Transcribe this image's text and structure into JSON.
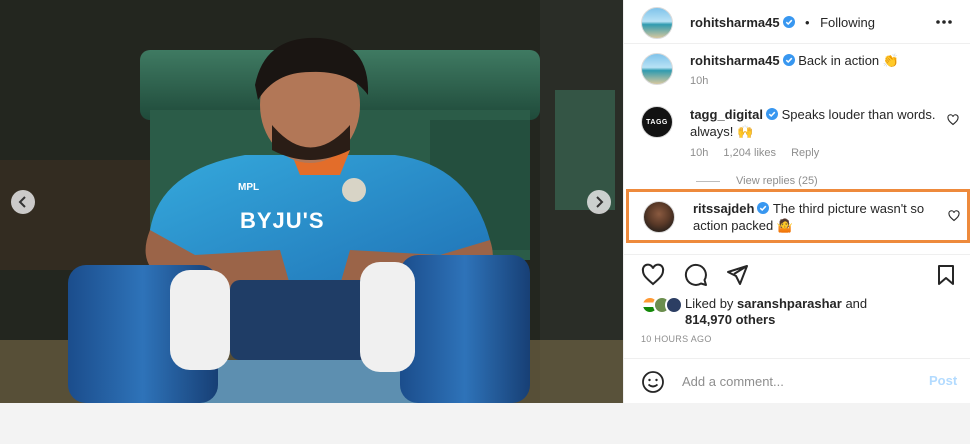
{
  "post": {
    "username": "rohitsharma45",
    "dot": "•",
    "follow_status": "Following",
    "caption": "Back in action 👏",
    "caption_time": "10h",
    "jersey_text": "BYJU'S",
    "jersey_brand": "MPL"
  },
  "comments": [
    {
      "username": "tagg_digital",
      "avatar_text": "TAGG",
      "text": "Speaks louder than words. always! 🙌",
      "time": "10h",
      "likes": "1,204 likes",
      "reply": "Reply",
      "view_replies": "View replies (25)"
    },
    {
      "username": "ritssajdeh",
      "text": "The third picture wasn't so action packed 🤷"
    }
  ],
  "likes": {
    "prefix": "Liked by",
    "user": "saranshparashar",
    "conj": "and",
    "others": "814,970 others"
  },
  "timestamp": "10 HOURS AGO",
  "composer": {
    "placeholder": "Add a comment...",
    "post_label": "Post"
  },
  "colors": {
    "highlight": "#ee8a3c",
    "verified": "#3897f0",
    "post_disabled": "#b3dbff"
  },
  "icons": [
    "chevron-left-icon",
    "chevron-right-icon",
    "more-icon",
    "verified-icon",
    "heart-icon",
    "comment-icon",
    "share-icon",
    "save-icon",
    "emoji-icon"
  ]
}
